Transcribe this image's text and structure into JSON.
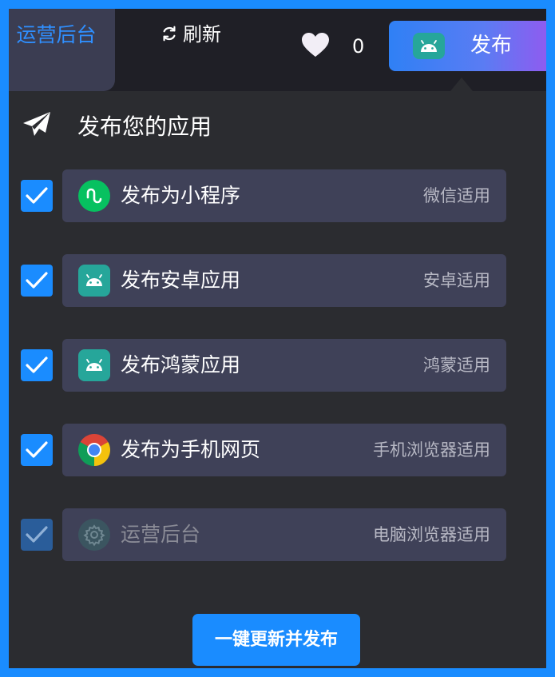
{
  "topbar": {
    "ops_tab_label": "运营后台",
    "refresh_label": "刷新",
    "like_count": "0",
    "publish_label": "发布"
  },
  "panel": {
    "title": "发布您的应用",
    "options": [
      {
        "label": "发布为小程序",
        "hint": "微信适用",
        "checked": true,
        "icon": "wechat-miniprogram-icon"
      },
      {
        "label": "发布安卓应用",
        "hint": "安卓适用",
        "checked": true,
        "icon": "android-icon"
      },
      {
        "label": "发布鸿蒙应用",
        "hint": "鸿蒙适用",
        "checked": true,
        "icon": "android-icon"
      },
      {
        "label": "发布为手机网页",
        "hint": "手机浏览器适用",
        "checked": true,
        "icon": "chrome-icon"
      },
      {
        "label": "运营后台",
        "hint": "电脑浏览器适用",
        "checked": true,
        "disabled": true,
        "icon": "gear-icon"
      }
    ],
    "cta_label": "一键更新并发布"
  },
  "colors": {
    "accent": "#1a8cff",
    "panel_bg": "#2b2c30",
    "card_bg": "#3f4158",
    "android_green": "#26a69a",
    "wechat_green": "#07c160"
  }
}
